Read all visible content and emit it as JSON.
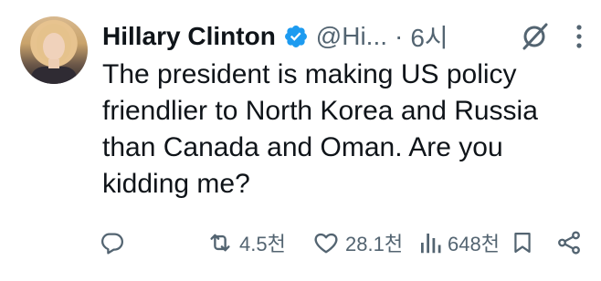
{
  "tweet": {
    "author_name": "Hillary Clinton",
    "handle": "@Hi...",
    "separator": "·",
    "time": "6시",
    "text": "The president is making US policy friendlier to North Korea and Russia than Canada and Oman. Are you kidding me?"
  },
  "actions": {
    "retweets": "4.5천",
    "likes": "28.1천",
    "views": "648천"
  },
  "icons": {
    "verified": "verified-badge-icon",
    "grok": "grok-icon",
    "more": "more-icon",
    "reply": "reply-icon",
    "retweet": "retweet-icon",
    "like": "heart-icon",
    "views": "views-bar-chart-icon",
    "bookmark": "bookmark-icon",
    "share": "share-icon"
  },
  "colors": {
    "text": "#0f1419",
    "secondary": "#536471",
    "verified": "#1d9bf0"
  }
}
